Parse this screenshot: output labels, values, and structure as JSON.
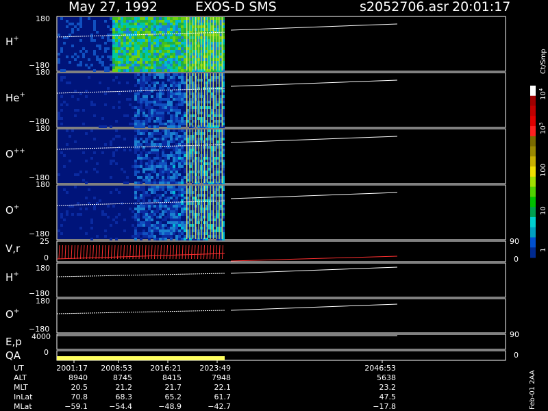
{
  "header": {
    "date": "May 27, 1992",
    "instrument": "EXOS-D SMS",
    "file": "s2052706.asr",
    "time": "20:01:17"
  },
  "panels": [
    {
      "label": "H",
      "sup": "+",
      "ymax": "180",
      "ymin": "−180",
      "intensity": 1.0
    },
    {
      "label": "He",
      "sup": "+",
      "ymax": "180",
      "ymin": "−180",
      "intensity": 0.55
    },
    {
      "label": "O",
      "sup": "++",
      "ymax": "180",
      "ymin": "−180",
      "intensity": 0.6
    },
    {
      "label": "O",
      "sup": "+",
      "ymax": "180",
      "ymin": "−180",
      "intensity": 0.65
    }
  ],
  "vr_panel": {
    "label": "V,r",
    "ymax": "25",
    "ymin": "0",
    "right_top": "90",
    "right_bottom": "0"
  },
  "line_panels": [
    {
      "label": "H",
      "sup": "+",
      "ymax": "180",
      "ymin": "−180"
    },
    {
      "label": "O",
      "sup": "+",
      "ymax": "180",
      "ymin": "−180"
    }
  ],
  "ep_panel": {
    "label": "E,p",
    "ymax": "4000",
    "right_top": "90"
  },
  "qa_panel": {
    "label": "QA",
    "ymin": "0",
    "right_bottom": "0"
  },
  "colorbar": {
    "unit": "Ct/Smp",
    "labels": [
      {
        "text": "10",
        "exp": "4"
      },
      {
        "text": "10",
        "exp": "3"
      },
      {
        "text": "100",
        "exp": ""
      },
      {
        "text": "10",
        "exp": ""
      },
      {
        "text": "1",
        "exp": ""
      }
    ],
    "colors": [
      "#ffffff",
      "#a00000",
      "#c00000",
      "#e00000",
      "#ff2020",
      "#7a6a00",
      "#9a8800",
      "#c8b000",
      "#f0e000",
      "#a0e000",
      "#50d000",
      "#00c000",
      "#00a050",
      "#00d0d0",
      "#00a0c0",
      "#0050d0",
      "#002a90"
    ]
  },
  "footer_table": {
    "rows": [
      {
        "name": "UT",
        "values": [
          "2001:17",
          "2008:53",
          "2016:21",
          "2023:49",
          "2046:53"
        ]
      },
      {
        "name": "ALT",
        "values": [
          "8940",
          "8745",
          "8415",
          "7948",
          "5638"
        ]
      },
      {
        "name": "MLT",
        "values": [
          "20.5",
          "21.2",
          "21.7",
          "22.1",
          "23.2"
        ]
      },
      {
        "name": "InLat",
        "values": [
          "70.8",
          "68.3",
          "65.2",
          "61.7",
          "47.5"
        ]
      },
      {
        "name": "MLat",
        "values": [
          "−59.1",
          "−54.4",
          "−48.9",
          "−42.7",
          "−17.8"
        ]
      }
    ]
  },
  "footnote": "Feb-01 2AA",
  "chart_data": {
    "type": "heatmap",
    "title": "May 27, 1992   EXOS-D SMS",
    "x_ticks": [
      "2001:17",
      "2008:53",
      "2016:21",
      "2023:49",
      "2046:53"
    ],
    "data_coverage_end_ut": "2023:49",
    "panels": [
      "H+",
      "He+",
      "O++",
      "O+",
      "V,r",
      "H+",
      "O+",
      "E,p",
      "QA"
    ],
    "ylim": [
      -180,
      180
    ],
    "colorbar": {
      "unit": "Ct/Smp",
      "scale": "log",
      "range": [
        1,
        10000
      ]
    }
  }
}
